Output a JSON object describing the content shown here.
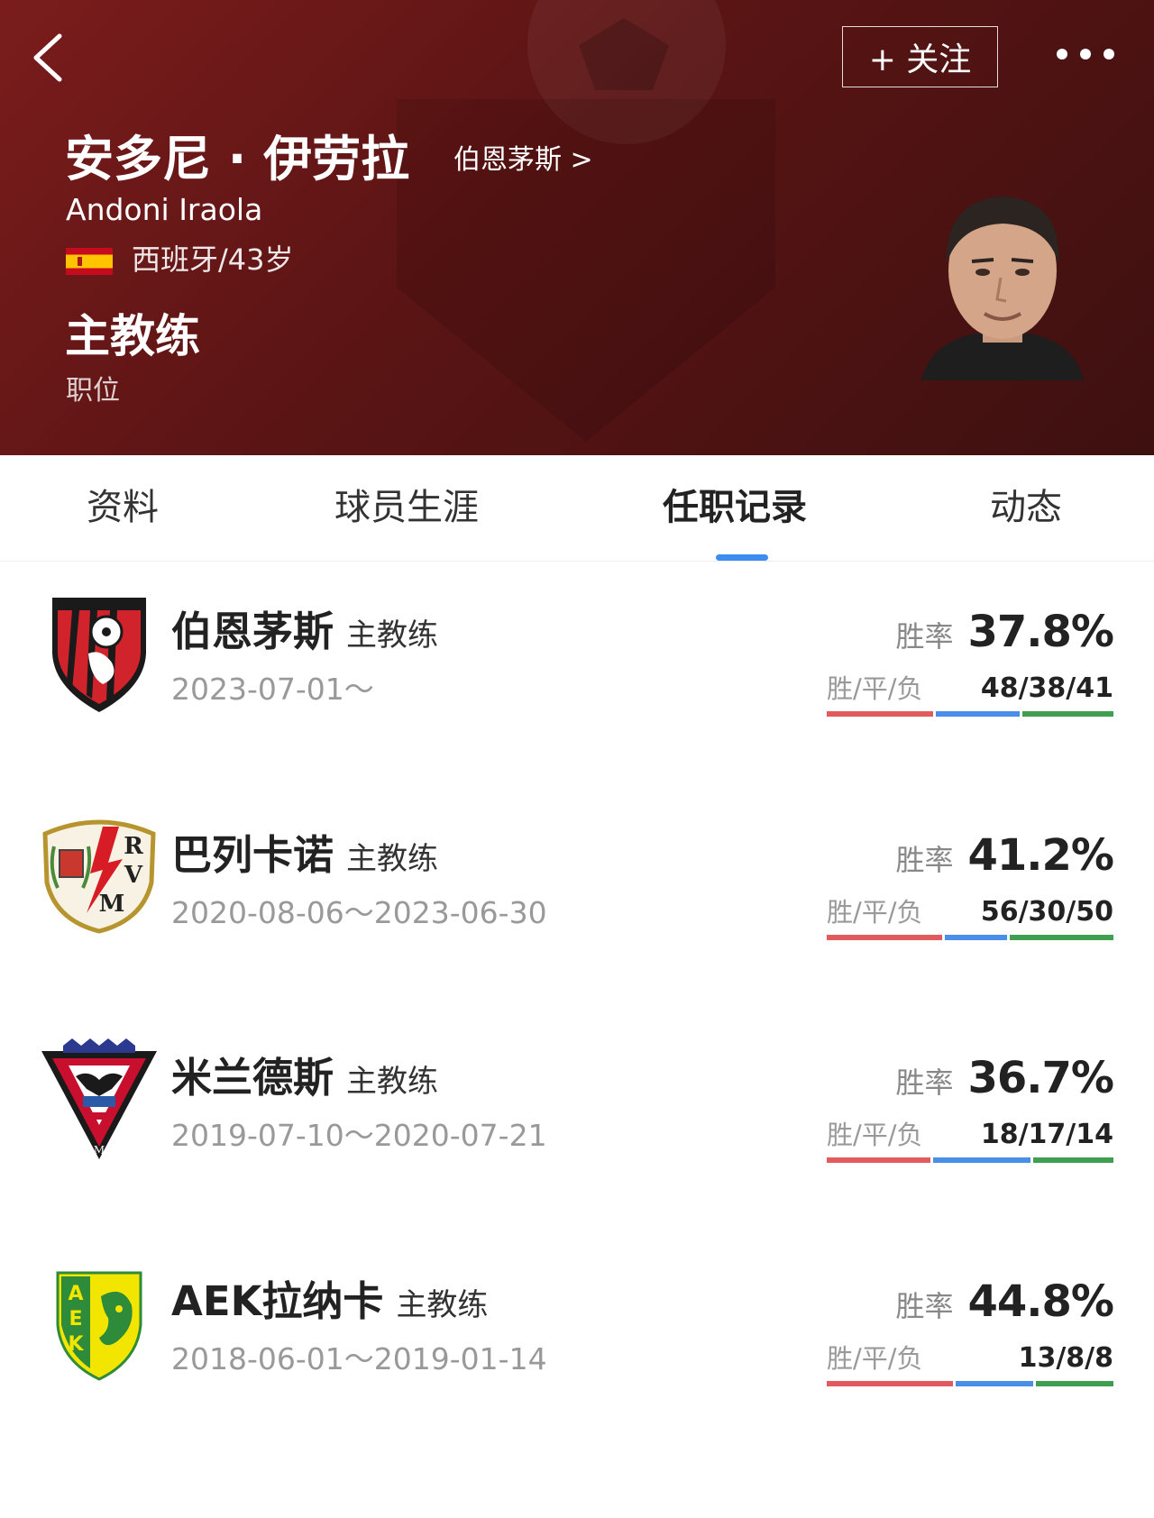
{
  "header": {
    "follow_label": "+ 关注",
    "name_cn": "安多尼 · 伊劳拉",
    "team_link": "伯恩茅斯 >",
    "name_en": "Andoni Iraola",
    "nationality_age": "西班牙/43岁",
    "position": "主教练",
    "position_label": "职位"
  },
  "tabs": [
    {
      "label": "资料"
    },
    {
      "label": "球员生涯"
    },
    {
      "label": "任职记录"
    },
    {
      "label": "动态"
    }
  ],
  "active_tab": "任职记录",
  "colors": {
    "win": "#e05a5e",
    "draw": "#4a8fe7",
    "loss": "#3f9e4f",
    "tab_indicator": "#3d8df0",
    "header_bg": "#5a1414"
  },
  "win_rate_label": "胜率",
  "wdl_label": "胜/平/负",
  "records": [
    {
      "club": "伯恩茅斯",
      "role": "主教练",
      "dates": "2023-07-01～",
      "win_rate": "37.8%",
      "wdl": "48/38/41",
      "w": 48,
      "d": 38,
      "l": 41,
      "logo": "bournemouth-logo"
    },
    {
      "club": "巴列卡诺",
      "role": "主教练",
      "dates": "2020-08-06～2023-06-30",
      "win_rate": "41.2%",
      "wdl": "56/30/50",
      "w": 56,
      "d": 30,
      "l": 50,
      "logo": "rayo-vallecano-logo"
    },
    {
      "club": "米兰德斯",
      "role": "主教练",
      "dates": "2019-07-10～2020-07-21",
      "win_rate": "36.7%",
      "wdl": "18/17/14",
      "w": 18,
      "d": 17,
      "l": 14,
      "logo": "mirandes-logo"
    },
    {
      "club": "AEK拉纳卡",
      "role": "主教练",
      "dates": "2018-06-01～2019-01-14",
      "win_rate": "44.8%",
      "wdl": "13/8/8",
      "w": 13,
      "d": 8,
      "l": 8,
      "logo": "aek-larnaca-logo"
    }
  ]
}
